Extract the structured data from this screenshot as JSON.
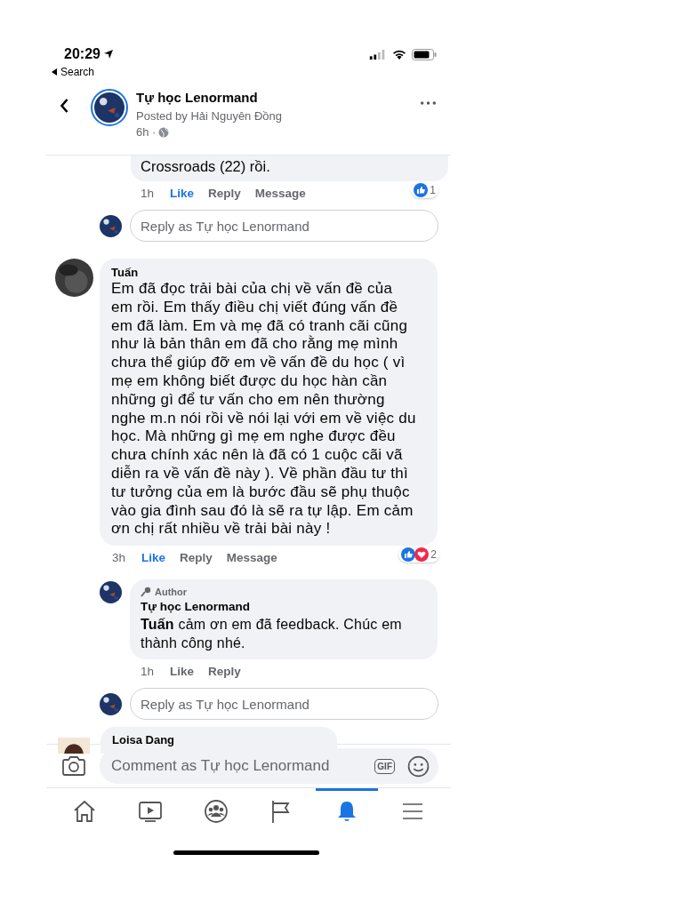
{
  "status_bar": {
    "time": "20:29",
    "back_label": "Search"
  },
  "header": {
    "title": "Tự học Lenormand",
    "subtitle": "Posted by Hải Nguyên Đồng",
    "time": "6h ·"
  },
  "feed": [
    {
      "kind": "cut_reply",
      "text": "Crossroads (22) rồi.",
      "time": "1h",
      "liked": true,
      "actions": [
        {
          "label": "Like",
          "kind": "like"
        },
        {
          "label": "Reply",
          "kind": "reply"
        },
        {
          "label": "Message",
          "kind": "message"
        }
      ],
      "reactions": [
        {
          "kind": "like"
        }
      ],
      "reaction_count": "1"
    },
    {
      "kind": "reply_box",
      "placeholder": "Reply as Tự học Lenormand"
    },
    {
      "kind": "comment",
      "author": "Tuấn",
      "text": "Em đã đọc trải bài của chị về vấn đề của em rồi. Em thấy điều chị viết đúng vấn đề em đã làm. Em và mẹ đã có tranh cãi cũng như là bản thân em đã cho rằng mẹ mình chưa thể giúp đỡ em về vấn đề du học ( vì mẹ em không biết được du học hàn cần những gì để tư vấn cho em nên thường nghe m.n nói rồi về nói lại với em về việc du học. Mà những gì mẹ em nghe được đều chưa chính xác nên là đã có 1 cuộc cãi vã diễn ra về vấn đề này ). Về phần đầu  tư thì tư tưởng của em là bước đầu sẽ phụ thuộc vào gia đình sau đó là sẽ ra tự lập. Em cảm ơn chị rất nhiều về trải bài này !",
      "time": "3h",
      "liked": true,
      "actions": [
        {
          "label": "Like",
          "kind": "like"
        },
        {
          "label": "Reply",
          "kind": "reply"
        },
        {
          "label": "Message",
          "kind": "message"
        }
      ],
      "reactions": [
        {
          "kind": "like"
        },
        {
          "kind": "love"
        }
      ],
      "reaction_count": "2"
    },
    {
      "kind": "reply",
      "badge": "Author",
      "author": "Tự học Lenormand",
      "text": "**Tuấn** cảm ơn em đã feedback. Chúc em thành công nhé.",
      "time": "1h",
      "liked": false,
      "actions": [
        {
          "label": "Like",
          "kind": "like"
        },
        {
          "label": "Reply",
          "kind": "reply"
        }
      ]
    },
    {
      "kind": "reply_box",
      "placeholder": "Reply as Tự học Lenormand"
    },
    {
      "kind": "cut_comment",
      "author": "Loisa Dang"
    }
  ],
  "composer": {
    "placeholder": "Comment as Tự học Lenormand",
    "gif_label": "GIF"
  },
  "tabs": [
    {
      "kind": "home",
      "selected": false
    },
    {
      "kind": "watch",
      "selected": false
    },
    {
      "kind": "groups",
      "selected": false
    },
    {
      "kind": "pages",
      "selected": false
    },
    {
      "kind": "notifications",
      "selected": true
    },
    {
      "kind": "menu",
      "selected": false
    }
  ]
}
